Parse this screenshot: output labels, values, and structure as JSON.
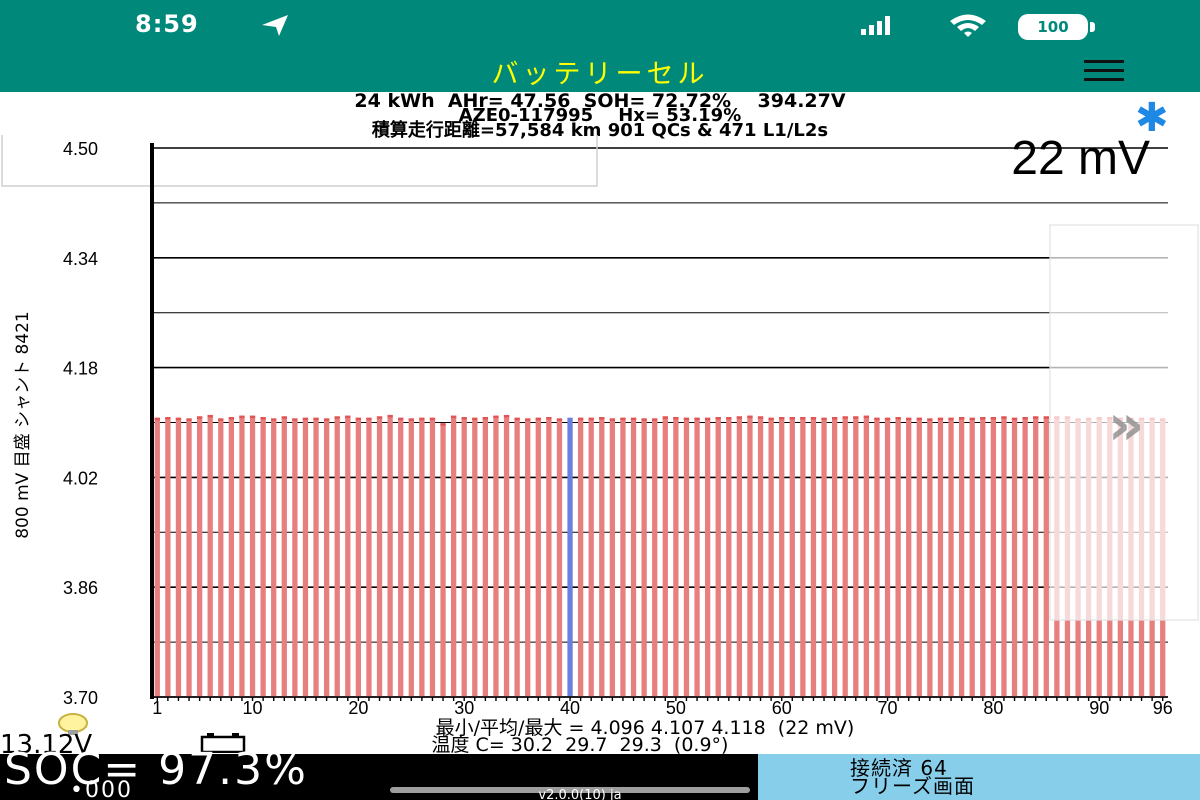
{
  "status_bar": {
    "time": "8:59",
    "battery_label": "100"
  },
  "app_bar": {
    "title": "バッテリーセル",
    "menu_icon": "hamburger-menu-icon"
  },
  "info": {
    "line1": "24 kWh  AHr= 47.56  SOH= 72.72%    394.27V",
    "line2": "AZE0-117995    Hx= 53.19%",
    "line3": "積算走行距離=57,584 km 901 QCs & 471 L1/L2s"
  },
  "chart": {
    "delta_label": "22 mV",
    "arrow_label": "»"
  },
  "chart_data": {
    "type": "bar",
    "ylabel": "800 mV 目盛  シャント 8421",
    "ylim": [
      3.7,
      4.5
    ],
    "y_ticks": [
      "4.50",
      "4.34",
      "4.18",
      "4.02",
      "3.86",
      "3.70"
    ],
    "x_ticks": [
      "1",
      "10",
      "20",
      "30",
      "40",
      "50",
      "60",
      "70",
      "80",
      "90",
      "96"
    ],
    "grid": true,
    "categories_count": 96,
    "highlight_index": 40,
    "highlight_color": "#6b7fe0",
    "bar_color": "#e87f7f",
    "series": [
      {
        "values": [
          4.107,
          4.108,
          4.107,
          4.106,
          4.109,
          4.111,
          4.106,
          4.108,
          4.11,
          4.11,
          4.108,
          4.106,
          4.109,
          4.106,
          4.107,
          4.107,
          4.106,
          4.109,
          4.11,
          4.107,
          4.107,
          4.109,
          4.111,
          4.107,
          4.106,
          4.107,
          4.107,
          4.099,
          4.11,
          4.108,
          4.107,
          4.108,
          4.11,
          4.111,
          4.107,
          4.106,
          4.107,
          4.108,
          4.106,
          4.107,
          4.107,
          4.107,
          4.108,
          4.106,
          4.107,
          4.107,
          4.106,
          4.106,
          4.109,
          4.108,
          4.107,
          4.107,
          4.107,
          4.108,
          4.108,
          4.109,
          4.11,
          4.109,
          4.107,
          4.108,
          4.108,
          4.108,
          4.108,
          4.107,
          4.108,
          4.109,
          4.109,
          4.11,
          4.107,
          4.107,
          4.108,
          4.107,
          4.107,
          4.106,
          4.107,
          4.107,
          4.108,
          4.107,
          4.108,
          4.108,
          4.109,
          4.107,
          4.108,
          4.109,
          4.109,
          4.109,
          4.109,
          4.106,
          4.107,
          4.108,
          4.108,
          4.107,
          4.107,
          4.107,
          4.107,
          4.106
        ]
      }
    ]
  },
  "stats": {
    "minmax_line": "最小/平均/最大 = 4.096 4.107 4.118  (22 mV)",
    "temp_line": "温度 C= 30.2  29.7  29.3  (0.9°)",
    "voltage": "13.12V"
  },
  "bottom": {
    "soc": "SOC= 97.3%",
    "dots": "•000",
    "version": "v2.0.0(10) ja",
    "connected": "接続済 64",
    "freeze": "フリーズ画面"
  }
}
